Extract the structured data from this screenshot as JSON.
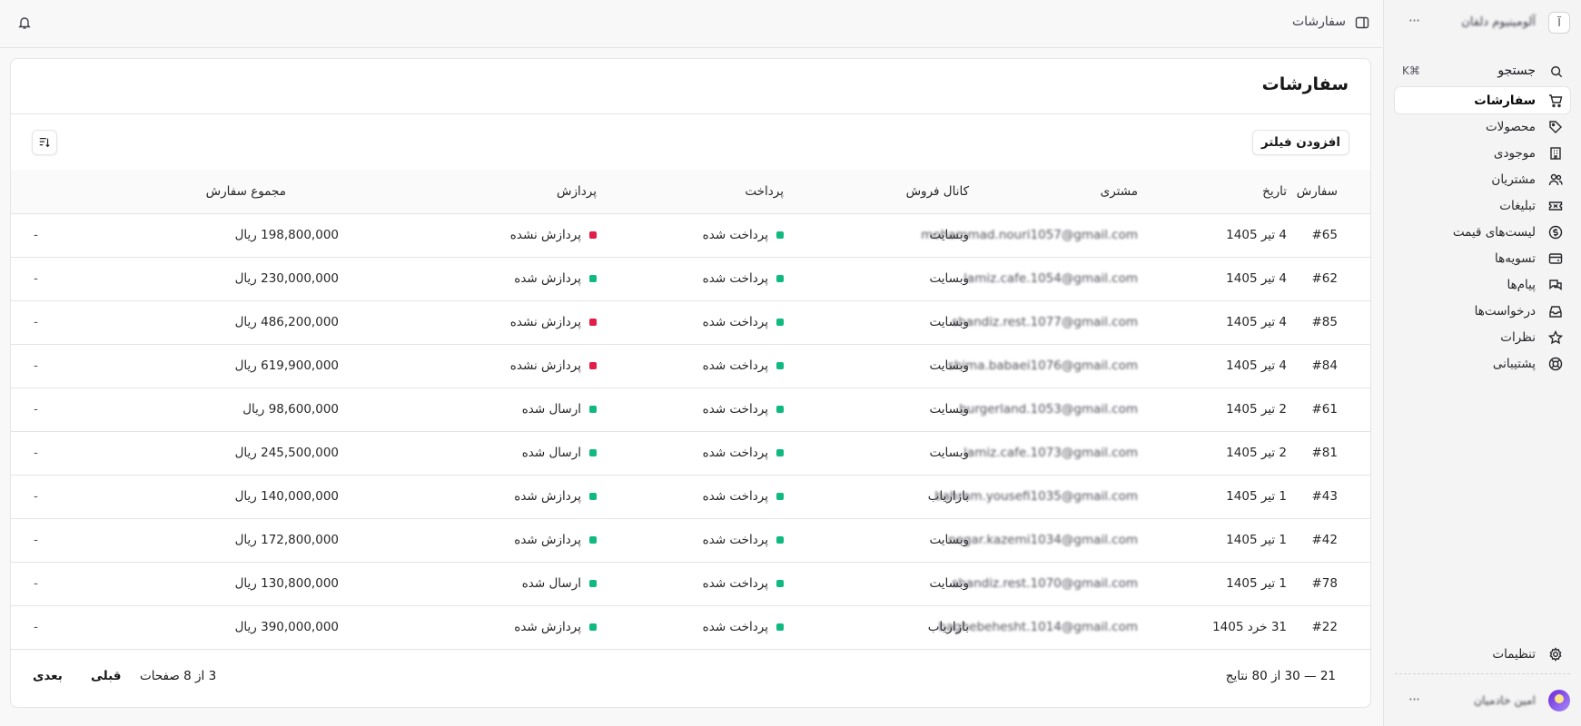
{
  "sidebar": {
    "store_initial": "آ",
    "store_name": "آلومینیوم دلفان",
    "more_label": "···",
    "search_label": "جستجو",
    "search_shortcut": "K⌘",
    "items": [
      {
        "label": "سفارشات",
        "icon": "cart-icon",
        "active": true
      },
      {
        "label": "محصولات",
        "icon": "tag-icon"
      },
      {
        "label": "موجودی",
        "icon": "building-icon"
      },
      {
        "label": "مشتریان",
        "icon": "users-icon"
      },
      {
        "label": "تبلیغات",
        "icon": "ticket-icon"
      },
      {
        "label": "لیست‌های قیمت",
        "icon": "dollar-circle-icon"
      },
      {
        "label": "تسویه‌ها",
        "icon": "card-icon"
      },
      {
        "label": "پیام‌ها",
        "icon": "chat-icon"
      },
      {
        "label": "درخواست‌ها",
        "icon": "inbox-icon"
      },
      {
        "label": "نظرات",
        "icon": "star-icon"
      },
      {
        "label": "پشتیبانی",
        "icon": "lifebuoy-icon"
      }
    ],
    "settings_label": "تنظیمات",
    "user_name": "امین خادمیان"
  },
  "header": {
    "breadcrumb": "سفارشات"
  },
  "main": {
    "title": "سفارشات",
    "add_filter_label": "افزودن فیلتر",
    "columns": [
      "سفارش",
      "تاریخ",
      "مشتری",
      "کانال فروش",
      "پرداخت",
      "پردازش",
      "مجموع سفارش"
    ],
    "rows": [
      {
        "id": "#65",
        "date": "4 تیر 1405",
        "customer": "mohammad.nouri1057@gmail.com",
        "channel": "وبسایت",
        "payment": "پرداخت شده",
        "payment_color": "#10b981",
        "fulfillment": "پردازش نشده",
        "fulfillment_color": "#e11d48",
        "total": "198,800,000 ریال",
        "extra": "-"
      },
      {
        "id": "#62",
        "date": "4 تیر 1405",
        "customer": "lamiz.cafe.1054@gmail.com",
        "channel": "وبسایت",
        "payment": "پرداخت شده",
        "payment_color": "#10b981",
        "fulfillment": "پردازش شده",
        "fulfillment_color": "#10b981",
        "total": "230,000,000 ریال",
        "extra": "-"
      },
      {
        "id": "#85",
        "date": "4 تیر 1405",
        "customer": "shandiz.rest.1077@gmail.com",
        "channel": "وبسایت",
        "payment": "پرداخت شده",
        "payment_color": "#10b981",
        "fulfillment": "پردازش نشده",
        "fulfillment_color": "#e11d48",
        "total": "486,200,000 ریال",
        "extra": "-"
      },
      {
        "id": "#84",
        "date": "4 تیر 1405",
        "customer": "shima.babaei1076@gmail.com",
        "channel": "وبسایت",
        "payment": "پرداخت شده",
        "payment_color": "#10b981",
        "fulfillment": "پردازش نشده",
        "fulfillment_color": "#e11d48",
        "total": "619,900,000 ریال",
        "extra": "-"
      },
      {
        "id": "#61",
        "date": "2 تیر 1405",
        "customer": "burgerland.1053@gmail.com",
        "channel": "وبسایت",
        "payment": "پرداخت شده",
        "payment_color": "#10b981",
        "fulfillment": "ارسال شده",
        "fulfillment_color": "#10b981",
        "total": "98,600,000 ریال",
        "extra": "-"
      },
      {
        "id": "#81",
        "date": "2 تیر 1405",
        "customer": "lamiz.cafe.1073@gmail.com",
        "channel": "وبسایت",
        "payment": "پرداخت شده",
        "payment_color": "#10b981",
        "fulfillment": "ارسال شده",
        "fulfillment_color": "#10b981",
        "total": "245,500,000 ریال",
        "extra": "-"
      },
      {
        "id": "#43",
        "date": "1 تیر 1405",
        "customer": "bahram.yousefi1035@gmail.com",
        "channel": "بازاریاب",
        "payment": "پرداخت شده",
        "payment_color": "#10b981",
        "fulfillment": "پردازش شده",
        "fulfillment_color": "#10b981",
        "total": "140,000,000 ریال",
        "extra": "-"
      },
      {
        "id": "#42",
        "date": "1 تیر 1405",
        "customer": "negar.kazemi1034@gmail.com",
        "channel": "وبسایت",
        "payment": "پرداخت شده",
        "payment_color": "#10b981",
        "fulfillment": "پردازش شده",
        "fulfillment_color": "#10b981",
        "total": "172,800,000 ریال",
        "extra": "-"
      },
      {
        "id": "#78",
        "date": "1 تیر 1405",
        "customer": "shandiz.rest.1070@gmail.com",
        "channel": "وبسایت",
        "payment": "پرداخت شده",
        "payment_color": "#10b981",
        "fulfillment": "ارسال شده",
        "fulfillment_color": "#10b981",
        "total": "130,800,000 ریال",
        "extra": "-"
      },
      {
        "id": "#22",
        "date": "31 خرد 1405",
        "customer": "baghebehesht.1014@gmail.com",
        "channel": "بازاریاب",
        "payment": "پرداخت شده",
        "payment_color": "#10b981",
        "fulfillment": "پردازش شده",
        "fulfillment_color": "#10b981",
        "total": "390,000,000 ریال",
        "extra": "-"
      }
    ],
    "pagination": {
      "range": "21 — 30 از 80 نتایج",
      "pages": "3 از 8 صفحات",
      "prev_label": "قبلی",
      "next_label": "بعدی"
    }
  }
}
